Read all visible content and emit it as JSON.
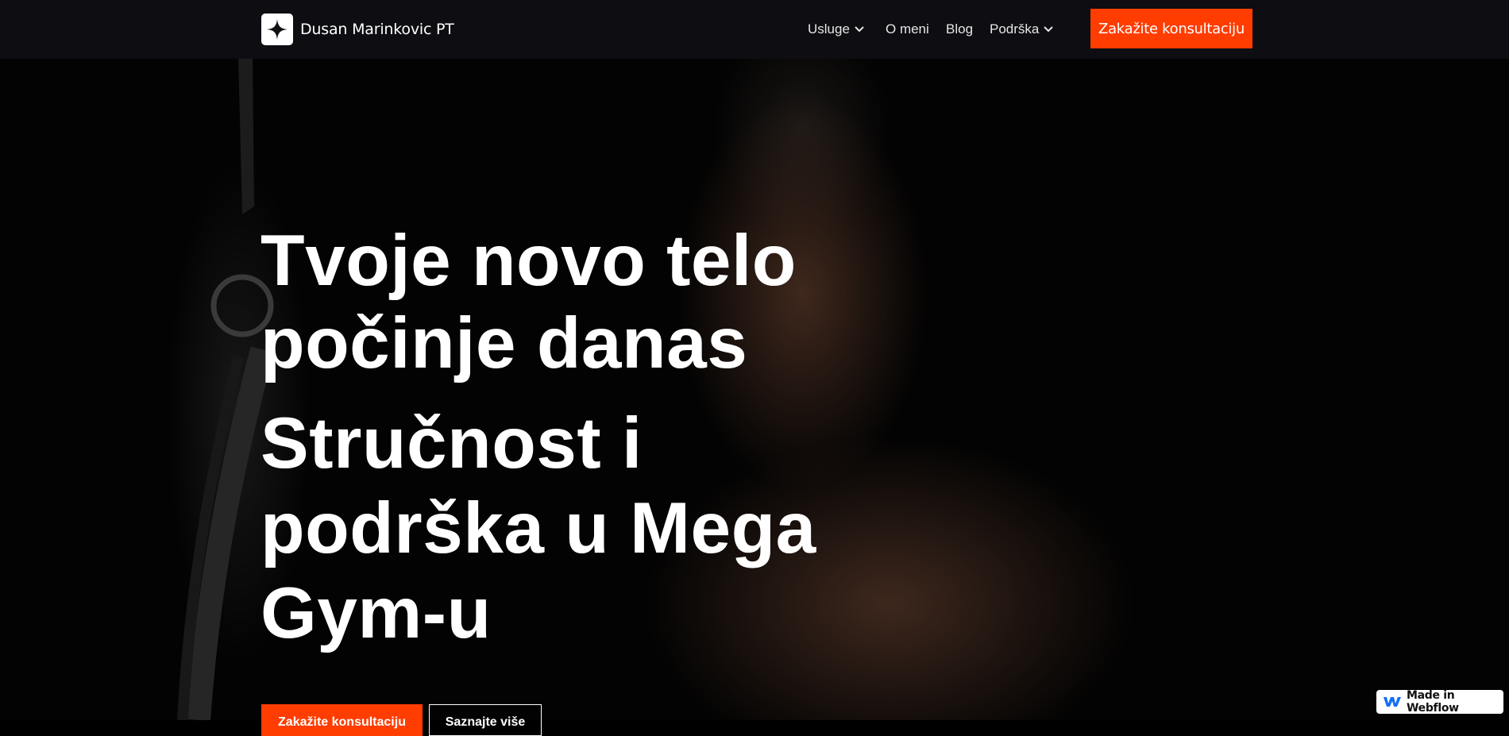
{
  "brand": {
    "name": "Dusan Marinkovic PT",
    "logo_icon": "four-point-star-icon"
  },
  "nav": {
    "items": [
      {
        "label": "Usluge",
        "has_dropdown": true
      },
      {
        "label": "O meni",
        "has_dropdown": false
      },
      {
        "label": "Blog",
        "has_dropdown": false
      },
      {
        "label": "Podrška",
        "has_dropdown": true
      }
    ],
    "cta_label": "Zakažite konsultaciju"
  },
  "hero": {
    "title": "Tvoje novo telo počinje danas",
    "subtitle": "Stručnost i podrška u Mega Gym-u",
    "primary_button": "Zakažite konsultaciju",
    "secondary_button": "Saznajte više"
  },
  "badge": {
    "label": "Made in Webflow",
    "icon": "webflow-logo-icon"
  },
  "colors": {
    "accent": "#ff3d00",
    "nav_bg": "#0d0d12",
    "background": "#000000"
  }
}
